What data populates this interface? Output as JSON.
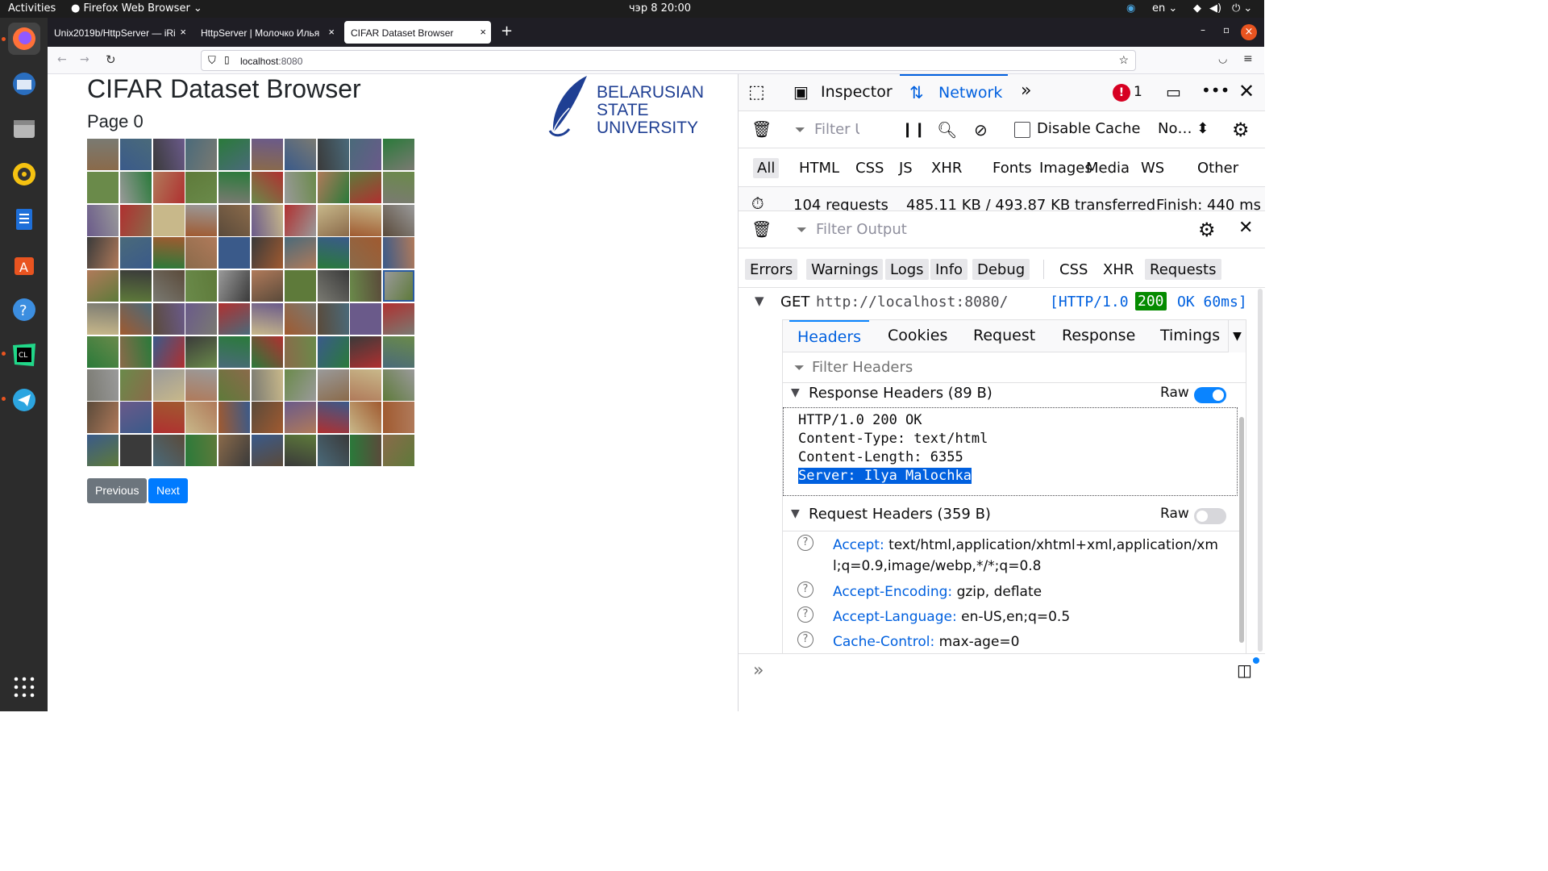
{
  "system": {
    "activities": "Activities",
    "app_menu": "Firefox Web Browser",
    "clock": "чэр 8  20:00",
    "lang": "en"
  },
  "tabs": [
    {
      "label": "Unix2019b/HttpServer — iRi"
    },
    {
      "label": "HttpServer | Молочко Илья"
    },
    {
      "label": "CIFAR Dataset Browser"
    }
  ],
  "url": {
    "host": "localhost",
    "port": ":8080"
  },
  "page": {
    "title": "CIFAR Dataset Browser",
    "subtitle": "Page 0",
    "logo_lines": [
      "BELARUSIAN",
      "STATE",
      "UNIVERSITY"
    ],
    "prev": "Previous",
    "next": "Next"
  },
  "devtools": {
    "tabs": {
      "inspector": "Inspector",
      "network": "Network",
      "error_count": "1"
    },
    "filter_urls": "Filter URLs",
    "disable_cache": "Disable Cache",
    "throttle": "No…",
    "types": [
      "All",
      "HTML",
      "CSS",
      "JS",
      "XHR",
      "Fonts",
      "Images",
      "Media",
      "WS",
      "Other"
    ],
    "summary": {
      "requests": "104 requests",
      "transferred": "485.11 KB / 493.87 KB transferred",
      "finish": "Finish: 440 ms"
    },
    "filter_output": "Filter Output",
    "levels": [
      "Errors",
      "Warnings",
      "Logs",
      "Info",
      "Debug"
    ],
    "extra": [
      "CSS",
      "XHR",
      "Requests"
    ],
    "request": {
      "method": "GET",
      "url": "http://localhost:8080/",
      "proto": "[HTTP/1.0",
      "status": "200",
      "status_text": "OK 60ms]"
    },
    "detail_tabs": [
      "Headers",
      "Cookies",
      "Request",
      "Response",
      "Timings"
    ],
    "filter_headers": "Filter Headers",
    "response_headers": {
      "title": "Response Headers (89 B)",
      "raw": "Raw",
      "lines": [
        "HTTP/1.0 200 OK",
        "Content-Type: text/html",
        "Content-Length: 6355"
      ],
      "highlight": "Server: Ilya Malochka"
    },
    "request_headers": {
      "title": "Request Headers (359 B)",
      "raw": "Raw",
      "items": [
        {
          "name": "Accept:",
          "value": "text/html,application/xhtml+xml,application/xm",
          "value2": "l;q=0.9,image/webp,*/*;q=0.8"
        },
        {
          "name": "Accept-Encoding:",
          "value": "gzip, deflate"
        },
        {
          "name": "Accept-Language:",
          "value": "en-US,en;q=0.5"
        },
        {
          "name": "Cache-Control:",
          "value": "max-age=0"
        }
      ]
    }
  },
  "colors": {
    "accent": "#0060df",
    "primary_btn": "#007bff",
    "secondary_btn": "#6c757d",
    "status_ok": "#058b00"
  }
}
